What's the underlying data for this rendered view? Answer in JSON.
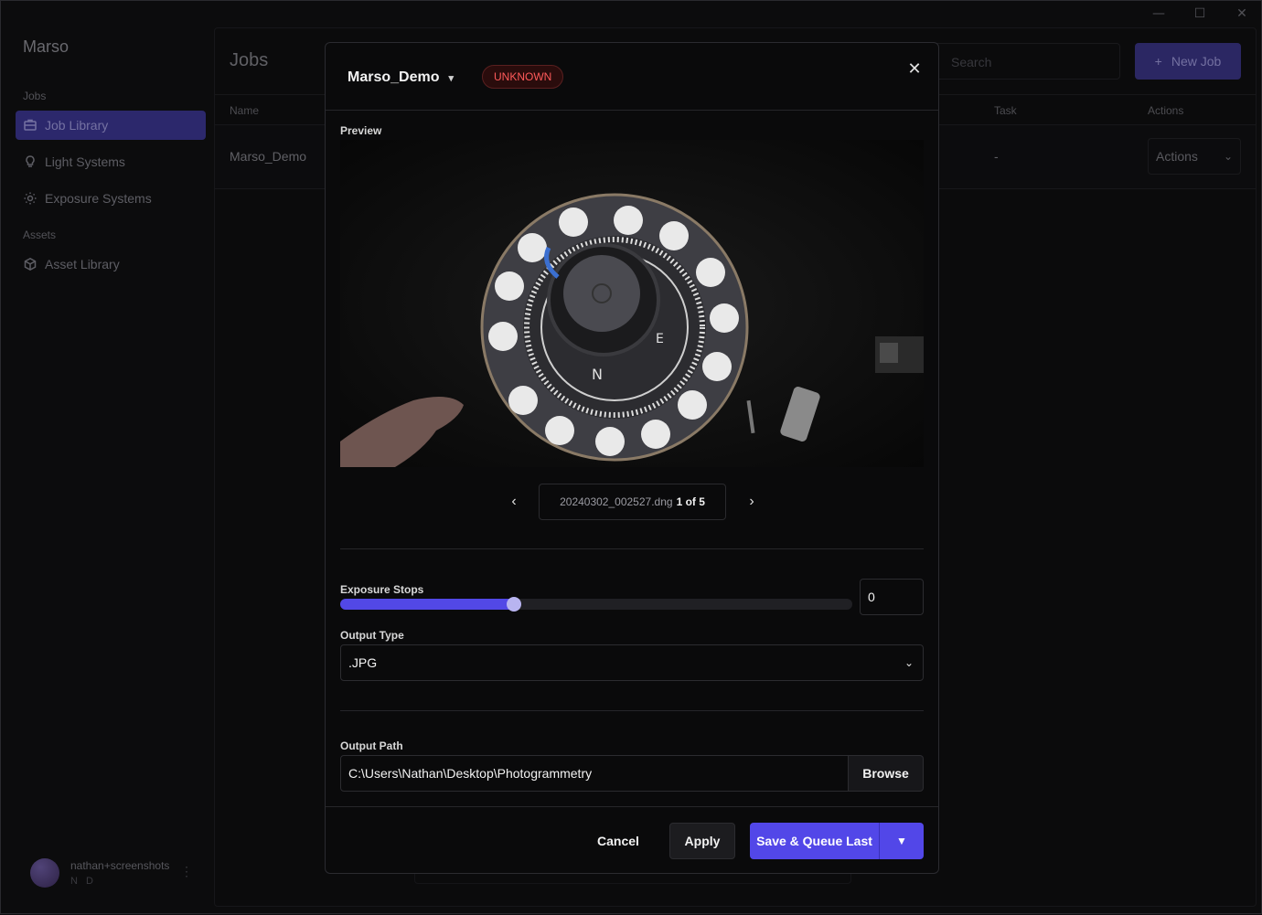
{
  "window": {
    "minimize": "—",
    "maximize": "☐",
    "close": "✕"
  },
  "sidebar": {
    "app_title": "Marso",
    "sections": [
      {
        "label": "Jobs"
      },
      {
        "label": "Assets"
      }
    ],
    "items": [
      {
        "label": "Job Library",
        "icon": "briefcase-icon",
        "active": true
      },
      {
        "label": "Light Systems",
        "icon": "lightbulb-icon",
        "active": false
      },
      {
        "label": "Exposure Systems",
        "icon": "sun-icon",
        "active": false
      },
      {
        "label": "Asset Library",
        "icon": "box-icon",
        "active": false
      }
    ],
    "user": {
      "name": "nathan+screenshots",
      "initials": "N D"
    }
  },
  "main": {
    "title": "Jobs",
    "search_placeholder": "Search",
    "new_job_label": "New Job",
    "columns": {
      "name": "Name",
      "task": "Task",
      "actions": "Actions"
    },
    "rows": [
      {
        "name": "Marso_Demo",
        "task": "-",
        "actions": "Actions"
      }
    ]
  },
  "modal": {
    "job_name": "Marso_Demo",
    "status_badge": "UNKNOWN",
    "preview_label": "Preview",
    "file_name": "20240302_002527.dng",
    "page_counter": "1 of 5",
    "exposure_label": "Exposure Stops",
    "exposure_value": "0",
    "exposure_slider_fraction": 0.34,
    "output_type_label": "Output Type",
    "output_type_value": ".JPG",
    "output_path_label": "Output Path",
    "output_path_value": "C:\\Users\\Nathan\\Desktop\\Photogrammetry",
    "browse_label": "Browse",
    "cancel_label": "Cancel",
    "apply_label": "Apply",
    "save_label": "Save & Queue Last"
  },
  "colors": {
    "accent": "#5247e8",
    "badge_red": "#ff5a5a",
    "active_nav": "#3b3690"
  }
}
